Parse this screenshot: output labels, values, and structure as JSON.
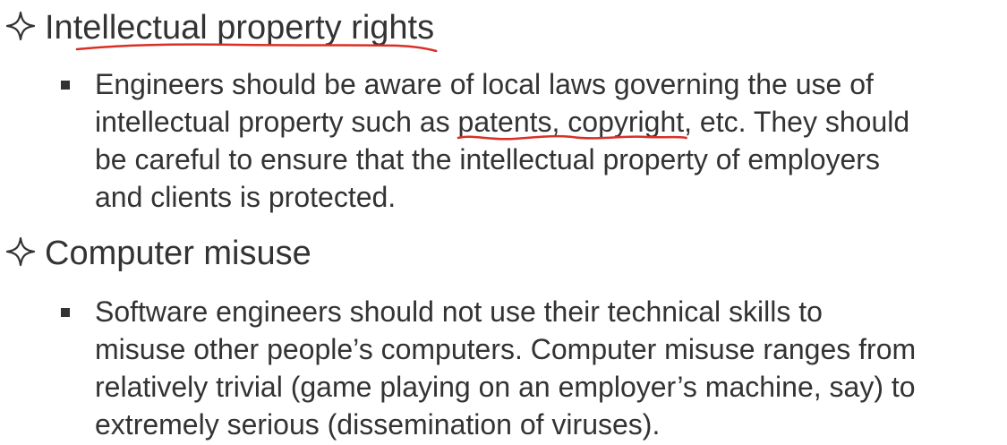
{
  "section1": {
    "heading": "Intellectual property rights",
    "lines": [
      "Engineers should be aware of local laws governing the use of",
      "intellectual property such as ",
      "patents, copyright",
      ", etc. They should",
      "be careful to ensure that the intellectual property of employers",
      "and clients is protected."
    ]
  },
  "section2": {
    "heading": "Computer misuse",
    "lines": [
      "Software engineers should not use their technical skills to",
      "misuse other people’s computers. Computer misuse ranges from",
      "relatively trivial (game playing on an employer’s machine, say) to",
      "extremely serious (dissemination of viruses)."
    ]
  },
  "colors": {
    "text": "#333333",
    "annotation": "#d93025",
    "background": "#ffffff"
  },
  "icons": {
    "heading_marker": "four-point-star-outline-icon",
    "bullet_marker": "square-bullet-icon",
    "annotation_mark": "red-underline-icon"
  }
}
